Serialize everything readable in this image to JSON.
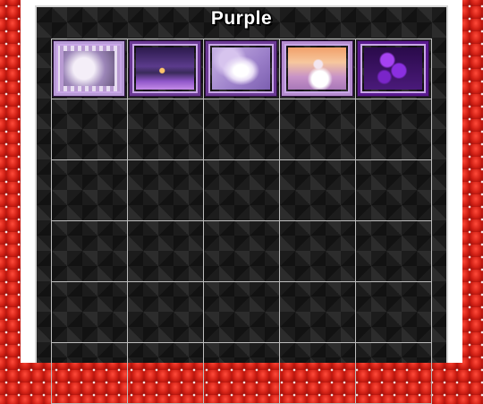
{
  "page": {
    "title": "Purple"
  },
  "grid": {
    "columns": 5,
    "rows": 6,
    "thumbnails": [
      {
        "name": "abstract-purple-collage-thumbnail"
      },
      {
        "name": "purple-cottage-night-thumbnail"
      },
      {
        "name": "white-lilies-thumbnail"
      },
      {
        "name": "woman-in-hat-sunset-thumbnail"
      },
      {
        "name": "purple-poppies-thumbnail"
      }
    ]
  },
  "colors": {
    "border_red": "#d9261c",
    "panel_dark": "#1c1c1c",
    "thumb_frame_purple": "#6c3a95",
    "grid_lines": "#bdbdbd"
  }
}
